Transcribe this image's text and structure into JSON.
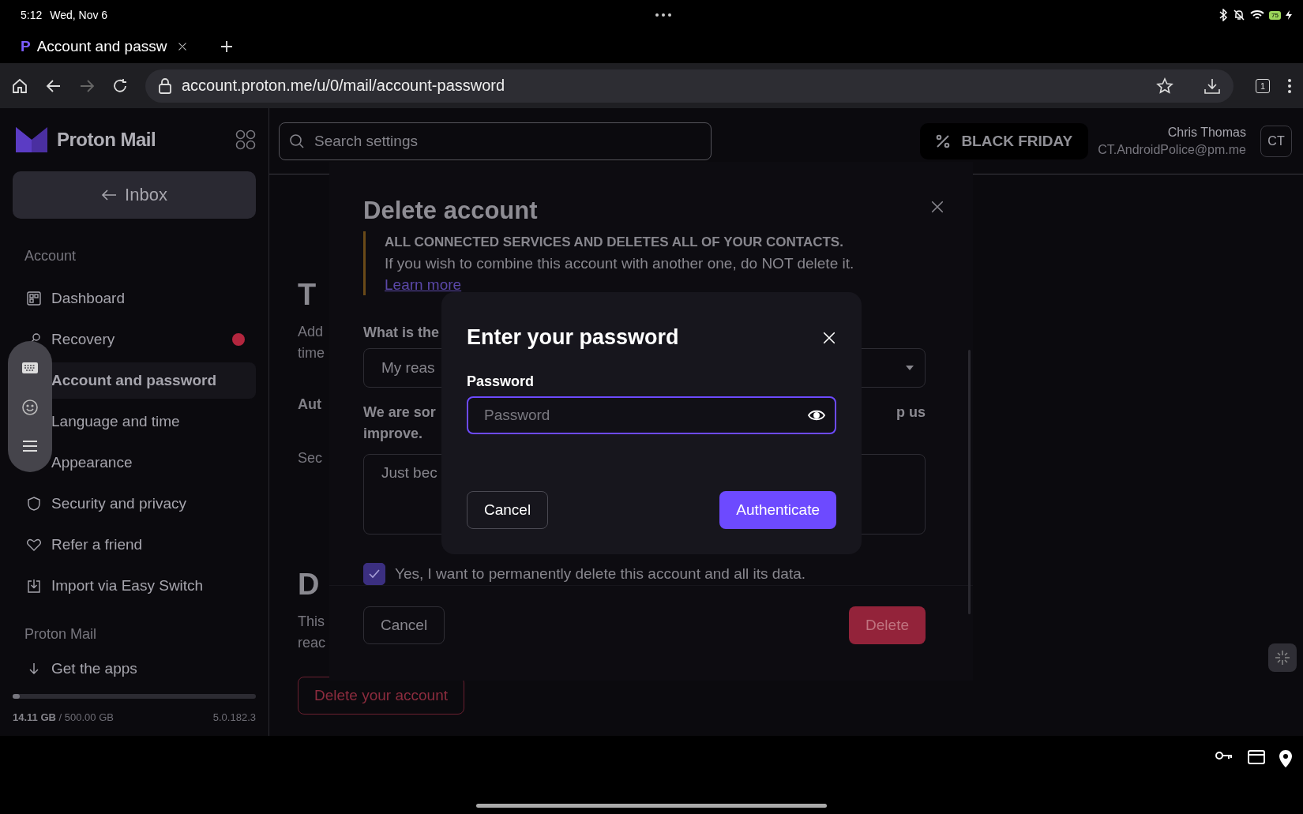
{
  "status_bar": {
    "time": "5:12",
    "date": "Wed, Nov 6",
    "battery": "75"
  },
  "browser": {
    "tab": {
      "logo": "P",
      "title": "Account and passw"
    },
    "url": "account.proton.me/u/0/mail/account-password",
    "tab_count": "1"
  },
  "sidebar": {
    "brand": "Proton Mail",
    "inbox_button": "Inbox",
    "sections": [
      {
        "title": "Account",
        "items": [
          {
            "label": "Dashboard",
            "selected": false,
            "alert": false
          },
          {
            "label": "Recovery",
            "selected": false,
            "alert": true
          },
          {
            "label": "Account and password",
            "selected": true,
            "alert": false
          },
          {
            "label": "Language and time",
            "selected": false,
            "alert": false
          },
          {
            "label": "Appearance",
            "selected": false,
            "alert": false
          },
          {
            "label": "Security and privacy",
            "selected": false,
            "alert": false
          },
          {
            "label": "Refer a friend",
            "selected": false,
            "alert": false
          },
          {
            "label": "Import via Easy Switch",
            "selected": false,
            "alert": false
          }
        ]
      },
      {
        "title": "Proton Mail",
        "items": [
          {
            "label": "Get the apps",
            "selected": false,
            "alert": false
          }
        ]
      }
    ],
    "storage": {
      "used": "14.11 GB",
      "total": "/ 500.00 GB",
      "level": 0.03
    },
    "version": "5.0.182.3"
  },
  "header": {
    "search_placeholder": "Search settings",
    "promo": "BLACK FRIDAY",
    "user_name": "Chris Thomas",
    "user_email": "CT.AndroidPolice@pm.me",
    "avatar": "CT"
  },
  "background_page": {
    "items": [
      {
        "kind": "heading",
        "text": "T"
      },
      {
        "kind": "text",
        "text": "Add"
      },
      {
        "kind": "text",
        "text": "time"
      },
      {
        "kind": "label",
        "text": "Aut"
      },
      {
        "kind": "subtext",
        "text": "Sec"
      },
      {
        "kind": "heading",
        "text": "D"
      },
      {
        "kind": "text",
        "text": "This"
      },
      {
        "kind": "text",
        "text": "reac"
      }
    ],
    "delete_button": "Delete your account"
  },
  "delete_dialog": {
    "title": "Delete account",
    "warning": [
      "ALL CONNECTED SERVICES AND DELETES ALL OF YOUR CONTACTS.",
      "If you wish to combine this account with another one, do NOT delete it."
    ],
    "learn_more": "Learn more",
    "reason_label": "What is the",
    "reason_value": "My reas",
    "feedback_label_start": "We are sor",
    "feedback_label_end": "p us",
    "feedback_label_line2": "improve.",
    "feedback_value": "Just bec",
    "confirm": {
      "label": "Yes, I want to permanently delete this account and all its data.",
      "checked": true
    },
    "cancel": "Cancel",
    "delete": "Delete"
  },
  "password_dialog": {
    "title": "Enter your password",
    "label": "Password",
    "placeholder": "Password",
    "cancel": "Cancel",
    "submit": "Authenticate"
  }
}
